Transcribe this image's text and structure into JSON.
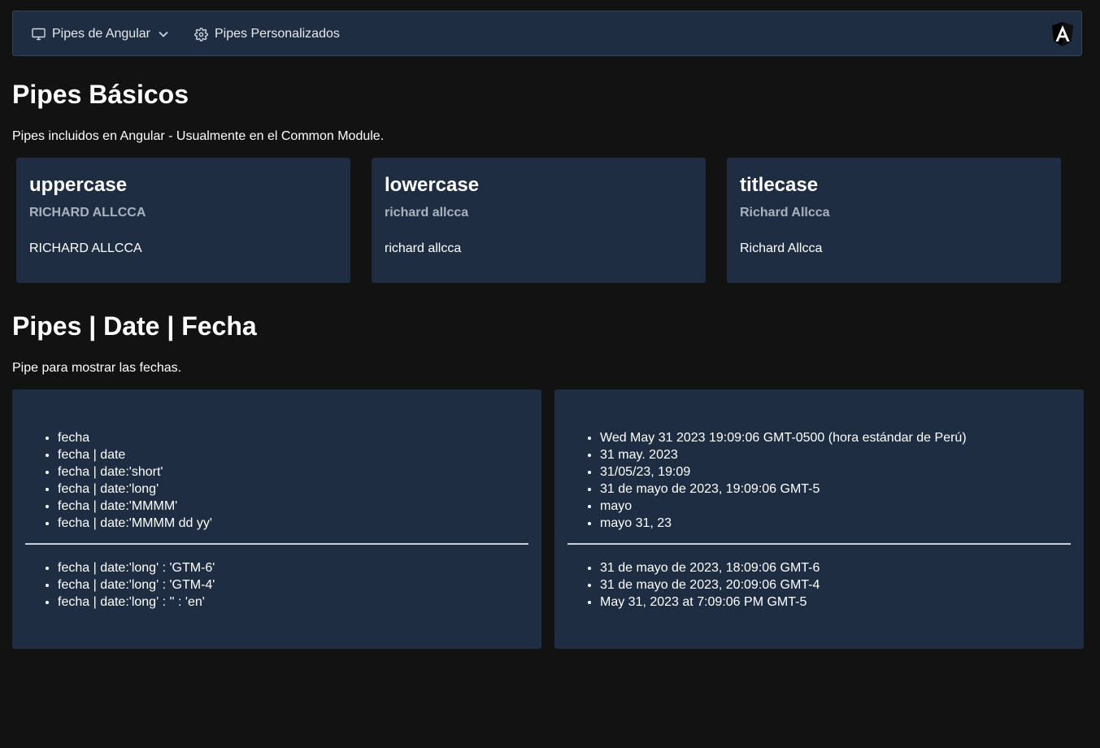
{
  "menubar": {
    "items": [
      {
        "label": "Pipes de Angular",
        "icon": "desktop-icon",
        "has_dropdown": true
      },
      {
        "label": "Pipes Personalizados",
        "icon": "gear-icon",
        "has_dropdown": false
      }
    ],
    "logo": "angular-logo"
  },
  "basic_section": {
    "title": "Pipes Básicos",
    "description": "Pipes incluidos en Angular - Usualmente en el Common Module.",
    "cards": [
      {
        "title": "uppercase",
        "subtitle": "RICHARD ALLCCA",
        "value": "RICHARD ALLCCA"
      },
      {
        "title": "lowercase",
        "subtitle": "richard allcca",
        "value": "richard allcca"
      },
      {
        "title": "titlecase",
        "subtitle": "Richard Allcca",
        "value": "Richard Allcca"
      }
    ]
  },
  "date_section": {
    "title": "Pipes | Date | Fecha",
    "description": "Pipe para mostrar las fechas.",
    "expressions_top": [
      "fecha",
      "fecha | date",
      "fecha | date:'short'",
      "fecha | date:'long'",
      "fecha | date:'MMMM'",
      "fecha | date:'MMMM dd yy'"
    ],
    "expressions_bottom": [
      "fecha | date:'long' : 'GTM-6'",
      "fecha | date:'long' : 'GTM-4'",
      "fecha | date:'long' : '' : 'en'"
    ],
    "results_top": [
      "Wed May 31 2023 19:09:06 GMT-0500 (hora estándar de Perú)",
      "31 may. 2023",
      "31/05/23, 19:09",
      "31 de mayo de 2023, 19:09:06 GMT-5",
      "mayo",
      "mayo 31, 23"
    ],
    "results_bottom": [
      "31 de mayo de 2023, 18:09:06 GMT-6",
      "31 de mayo de 2023, 20:09:06 GMT-4",
      "May 31, 2023 at 7:09:06 PM GMT-5"
    ]
  },
  "colors": {
    "background": "#121212",
    "panel": "#1f2d42",
    "muted_text": "#a9b2bf"
  }
}
